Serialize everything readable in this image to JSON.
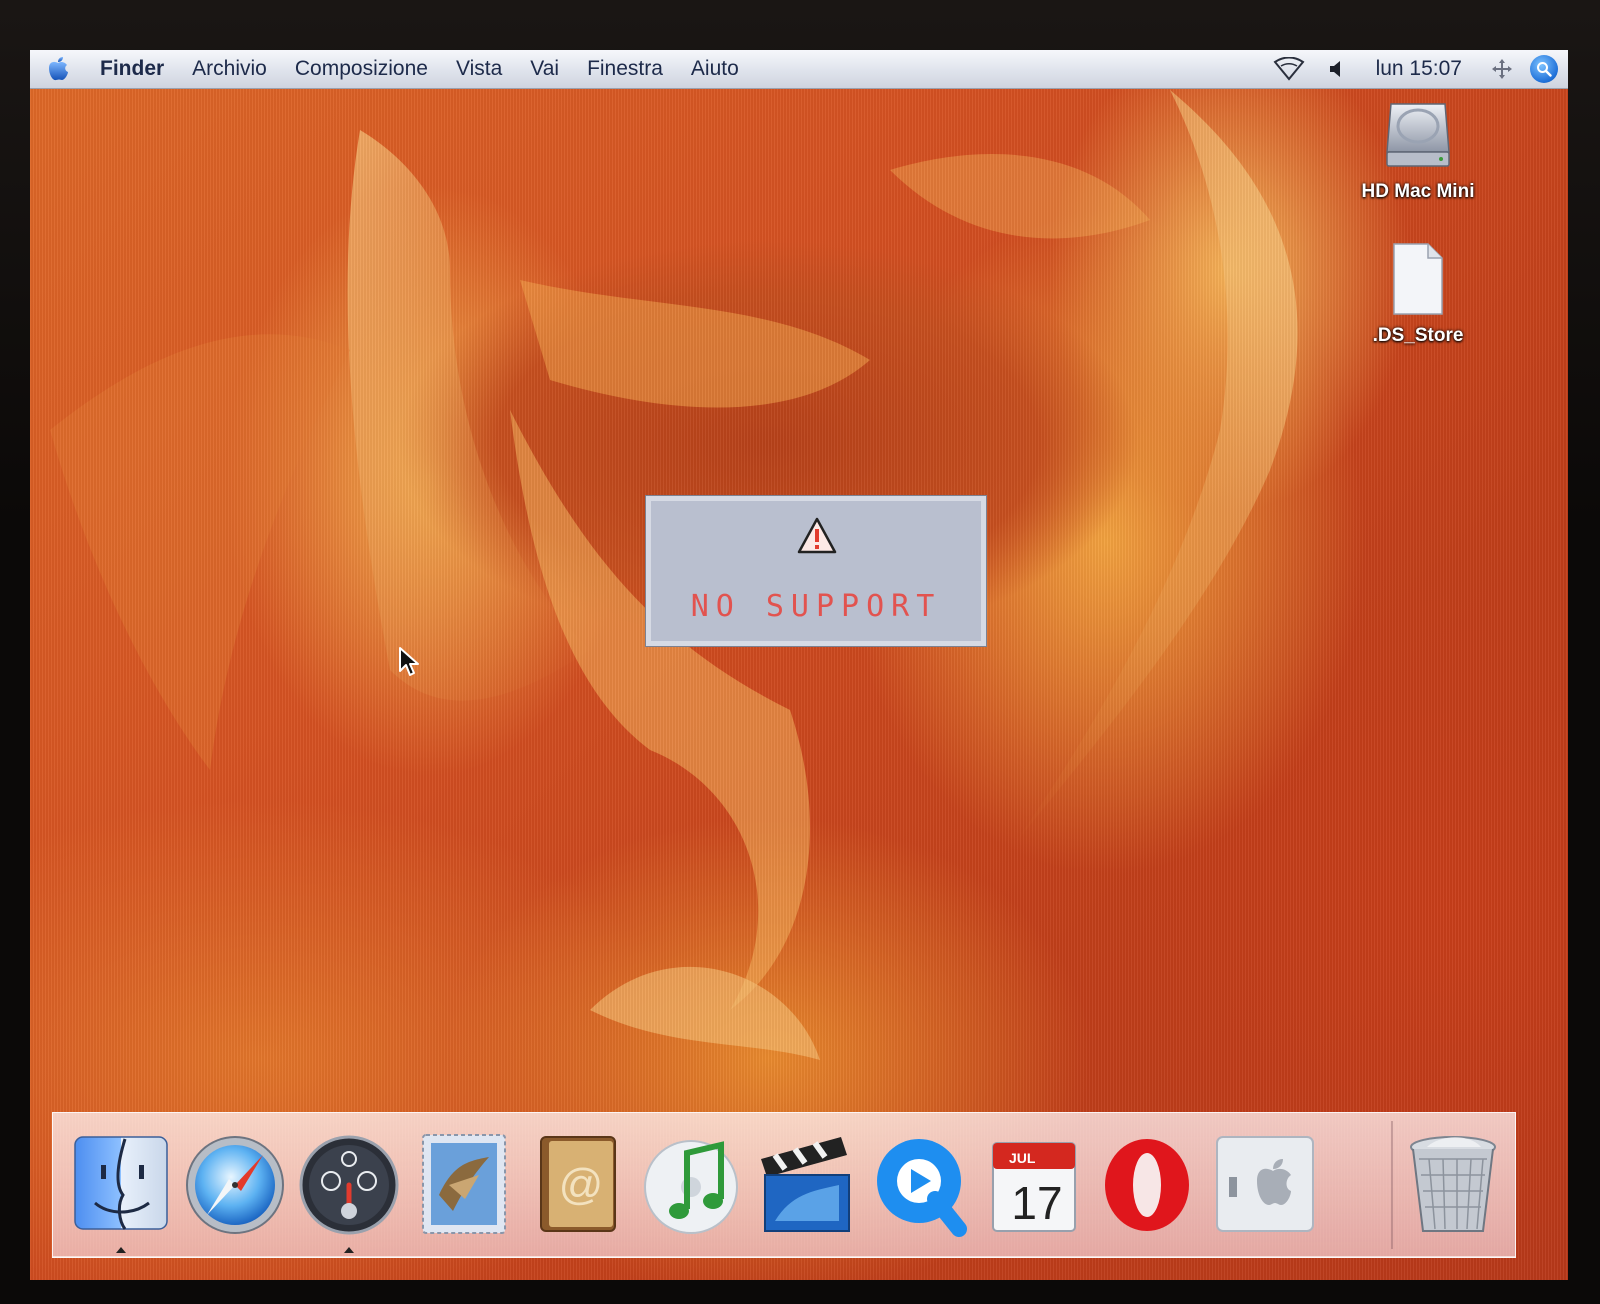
{
  "menubar": {
    "app_name": "Finder",
    "menus": [
      "Archivio",
      "Composizione",
      "Vista",
      "Vai",
      "Finestra",
      "Aiuto"
    ],
    "clock": "lun 15:07"
  },
  "desktop": {
    "icons": [
      {
        "label": "HD Mac Mini",
        "icon": "hard-drive-icon"
      },
      {
        "label": ".DS_Store",
        "icon": "document-icon"
      }
    ]
  },
  "dialog": {
    "message": "NO SUPPORT",
    "icon": "warning-icon"
  },
  "dock": {
    "items": [
      {
        "name": "finder",
        "icon": "finder-icon",
        "running": true
      },
      {
        "name": "safari",
        "icon": "safari-compass-icon",
        "running": false
      },
      {
        "name": "dashboard",
        "icon": "dashboard-icon",
        "running": true
      },
      {
        "name": "mail",
        "icon": "mail-stamp-icon",
        "running": false
      },
      {
        "name": "address-book",
        "icon": "address-book-icon",
        "running": false
      },
      {
        "name": "itunes",
        "icon": "itunes-icon",
        "running": false
      },
      {
        "name": "imovie",
        "icon": "imovie-clapboard-icon",
        "running": false
      },
      {
        "name": "quicktime",
        "icon": "quicktime-icon",
        "running": false
      },
      {
        "name": "ical",
        "icon": "ical-calendar-icon",
        "running": false,
        "month": "JUL",
        "day": "17"
      },
      {
        "name": "opera",
        "icon": "opera-icon",
        "running": false
      },
      {
        "name": "system-preferences",
        "icon": "apple-switch-icon",
        "running": false
      },
      {
        "name": "trash",
        "icon": "trash-icon",
        "running": false
      }
    ]
  },
  "colors": {
    "menubar": "#dfe3ec",
    "wallpaper": "#d55122",
    "dialog_bg": "#b9bfcf",
    "dialog_text": "#e2534f",
    "dock_bg": "#f5d2d7"
  }
}
